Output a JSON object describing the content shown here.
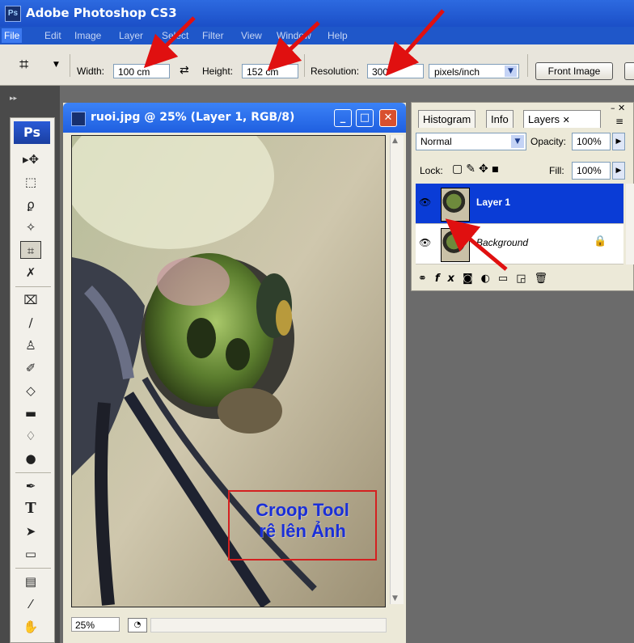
{
  "app": {
    "title": "Adobe Photoshop CS3",
    "logo": "Ps"
  },
  "menu": [
    "File",
    "Edit",
    "Image",
    "Layer",
    "Select",
    "Filter",
    "View",
    "Window",
    "Help"
  ],
  "options": {
    "width_label": "Width:",
    "width_value": "100 cm",
    "height_label": "Height:",
    "height_value": "152 cm",
    "resolution_label": "Resolution:",
    "resolution_value": "300",
    "units": "pixels/inch",
    "front_image_button": "Front Image"
  },
  "toolbox": {
    "logo": "Ps"
  },
  "document": {
    "title": "ruoi.jpg @ 25% (Layer 1, RGB/8)",
    "zoom": "25%",
    "caption_line1": "Croop Tool",
    "caption_line2": "rê lên Ảnh"
  },
  "layers_panel": {
    "tabs": [
      "Histogram",
      "Info",
      "Layers"
    ],
    "blend_mode": "Normal",
    "opacity_label": "Opacity:",
    "opacity_value": "100%",
    "lock_label": "Lock:",
    "fill_label": "Fill:",
    "fill_value": "100%",
    "layers": [
      {
        "name": "Layer 1",
        "selected": true
      },
      {
        "name": "Background",
        "selected": false
      }
    ]
  },
  "colors": {
    "titlebar": "#1b4fc7",
    "selection": "#0a3cd6",
    "annotation": "#e01010",
    "caption_text": "#1a2fd8"
  }
}
